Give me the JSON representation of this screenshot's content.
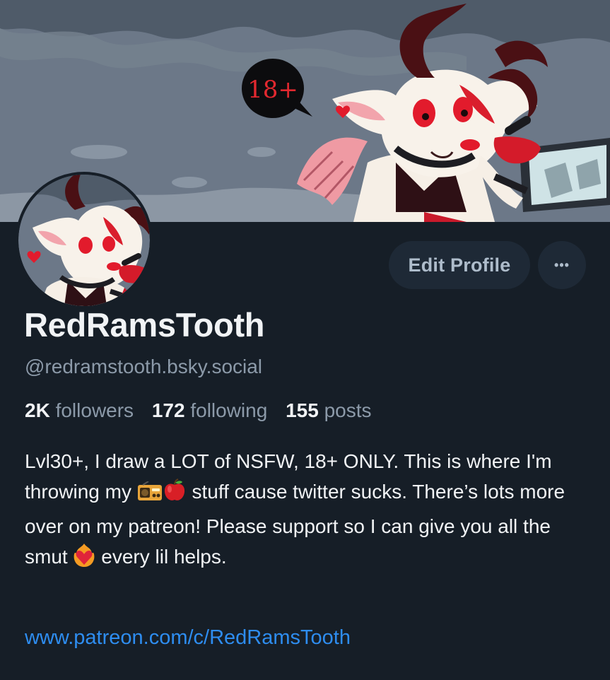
{
  "banner": {
    "speech_bubble_text": "18+"
  },
  "actions": {
    "edit_profile_label": "Edit Profile",
    "more_label": "•••"
  },
  "profile": {
    "display_name": "RedRamsTooth",
    "handle": "@redramstooth.bsky.social"
  },
  "stats": {
    "followers_count": "2K",
    "followers_label": "followers",
    "following_count": "172",
    "following_label": "following",
    "posts_count": "155",
    "posts_label": "posts"
  },
  "bio": {
    "part1": "Lvl30+, I draw a LOT of NSFW, 18+ ONLY. This is where I'm throwing my ",
    "emoji1": "radio-emoji",
    "emoji2": "apple-emoji",
    "part2": " stuff cause twitter sucks. There’s lots more over on my patreon! Please support so I can give you all the smut ",
    "emoji3": "heart-on-fire-emoji",
    "part3": " every lil helps."
  },
  "link": {
    "url_text": "www.patreon.com/c/RedRamsTooth"
  },
  "colors": {
    "background": "#161e27",
    "accent_link": "#2e8df0",
    "button_bg": "#1e2936"
  }
}
